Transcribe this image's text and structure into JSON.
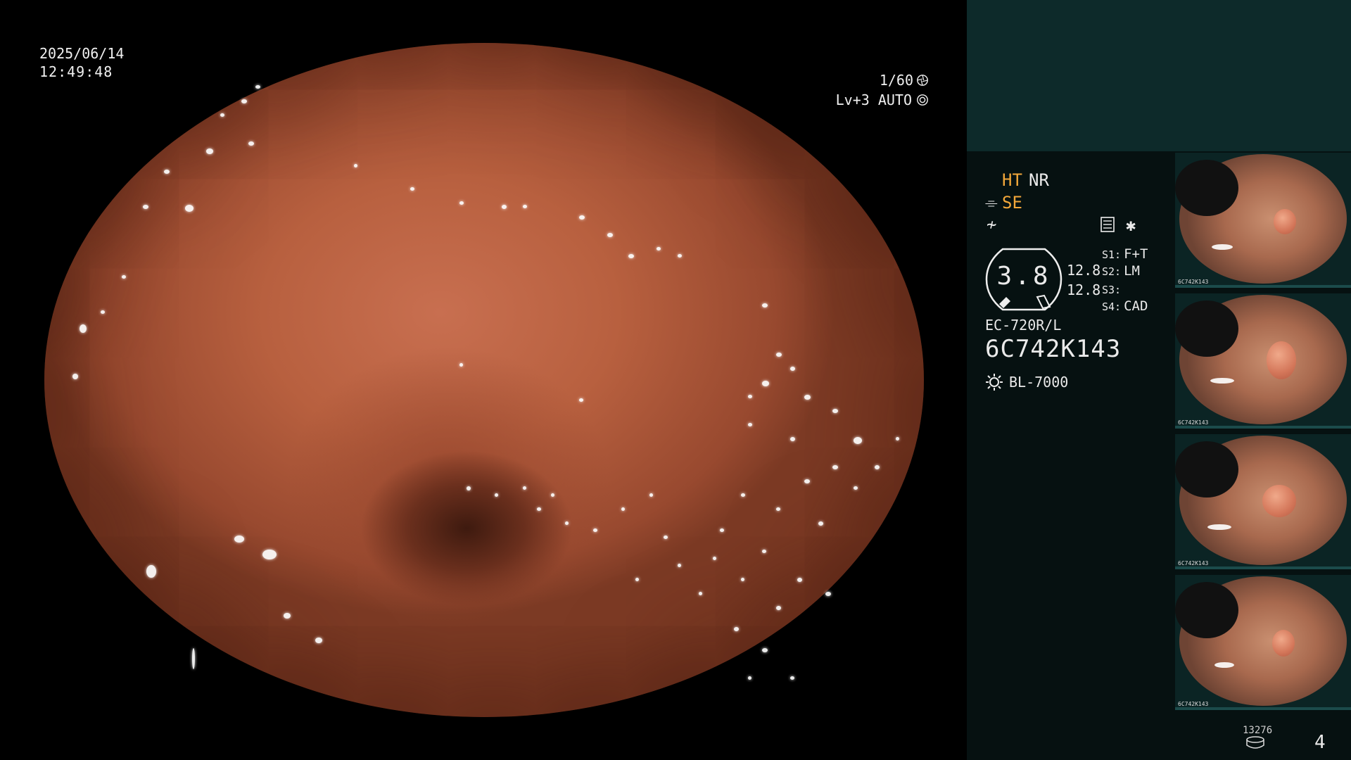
{
  "overlay": {
    "date": "2025/06/14",
    "time": "12:49:48",
    "shutter": "1/60",
    "level": "Lv+3 AUTO"
  },
  "panel": {
    "ht": "HT",
    "nr": "NR",
    "se": "SE",
    "zoom": {
      "value": "3.8",
      "r1": "12.8",
      "r2": "12.8"
    },
    "settings": [
      {
        "key": "S1:",
        "value": "F+T"
      },
      {
        "key": "S2:",
        "value": "LM"
      },
      {
        "key": "S3:",
        "value": ""
      },
      {
        "key": "S4:",
        "value": "CAD"
      }
    ],
    "model": "EC-720R/L",
    "serial": "6C742K143",
    "light_source": "BL-7000",
    "image_count": "13276",
    "page": "4"
  },
  "thumbnails": [
    {
      "label": "6C742K143"
    },
    {
      "label": "6C742K143"
    },
    {
      "label": "6C742K143"
    },
    {
      "label": "6C742K143"
    }
  ],
  "colors": {
    "accent_orange": "#f2a73a",
    "panel_top": "#0d2a2a",
    "panel_bg": "#061111"
  },
  "icons": [
    "shutter-icon",
    "auto-iris-icon",
    "structure-enhance-icon",
    "memo-icon",
    "light-source-icon",
    "disk-icon"
  ]
}
